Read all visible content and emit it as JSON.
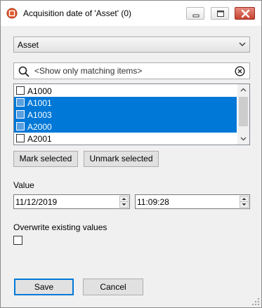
{
  "window": {
    "title": "Acquisition date of 'Asset' (0)"
  },
  "combo": {
    "selected": "Asset"
  },
  "search": {
    "placeholder": "<Show only matching items>"
  },
  "list": {
    "items": [
      {
        "label": "A1000",
        "selected": false
      },
      {
        "label": "A1001",
        "selected": true
      },
      {
        "label": "A1003",
        "selected": true
      },
      {
        "label": "A2000",
        "selected": true
      },
      {
        "label": "A2001",
        "selected": false
      }
    ]
  },
  "buttons": {
    "mark_selected": "Mark selected",
    "unmark_selected": "Unmark selected",
    "save": "Save",
    "cancel": "Cancel"
  },
  "value": {
    "label": "Value",
    "date": "11/12/2019",
    "time": "11:09:28"
  },
  "overwrite": {
    "label": "Overwrite existing values",
    "checked": false
  },
  "colors": {
    "selection": "#0078d7",
    "close_button": "#c64330"
  }
}
